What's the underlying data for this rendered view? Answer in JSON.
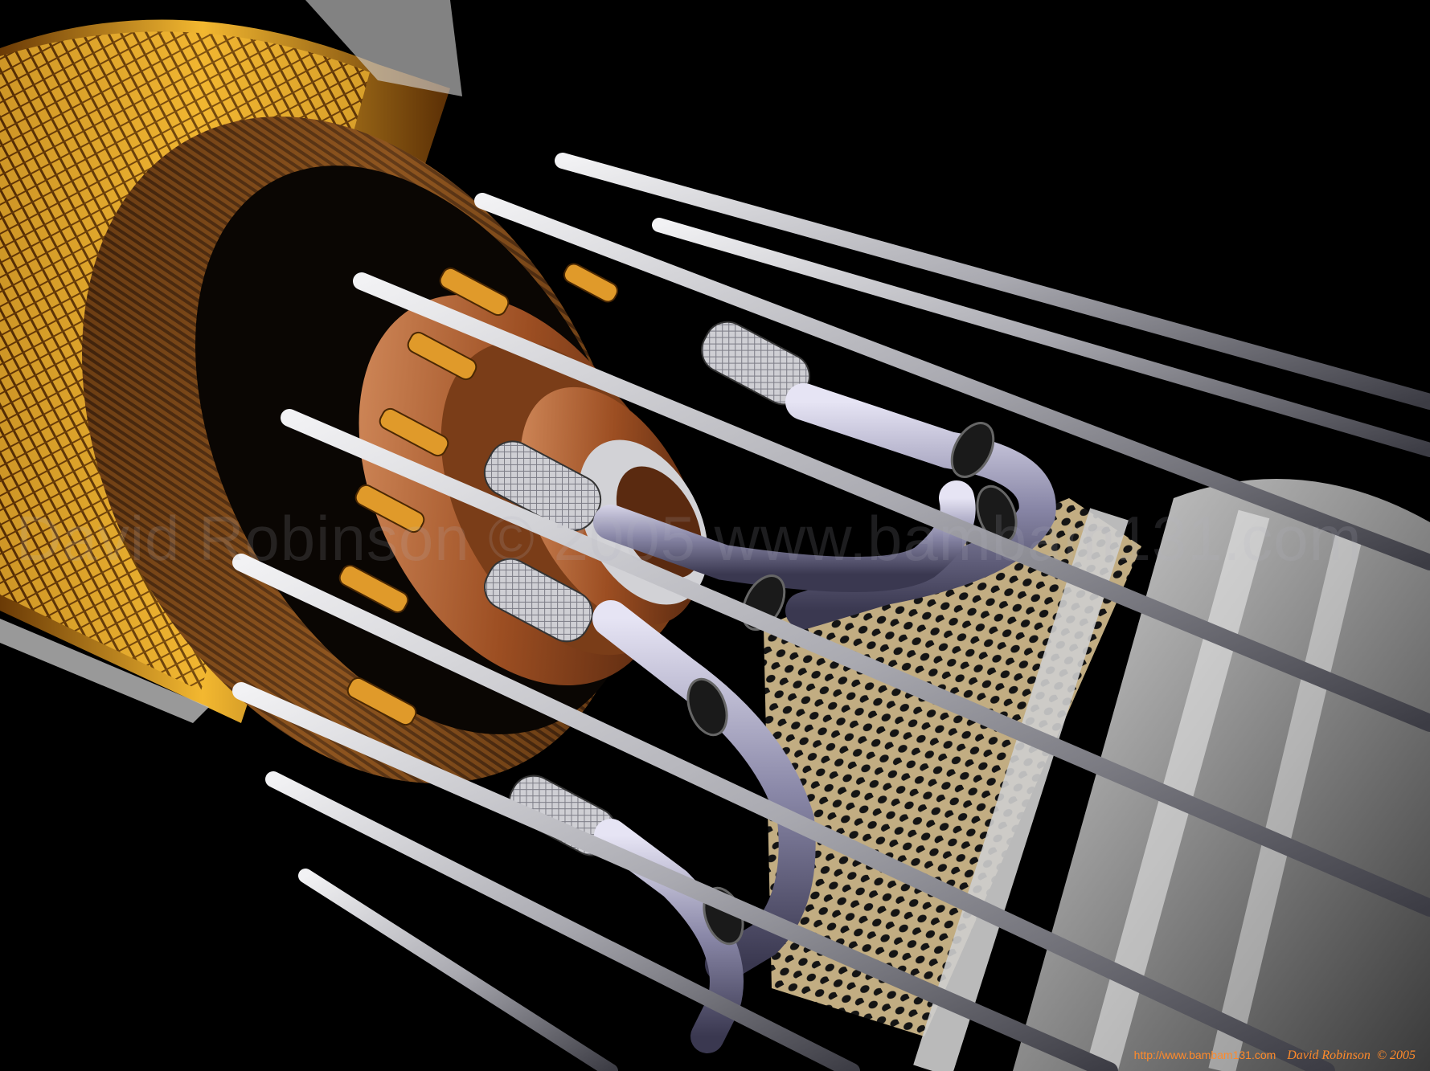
{
  "watermark_text": "David Robinson © 2005 www.bambam131.com",
  "credit": {
    "url": "http://www.bambam131.com",
    "signature": "David Robinson",
    "year": "© 2005"
  },
  "colors": {
    "background": "#000000",
    "copper": "#b5673a",
    "gold": "#e0a020",
    "steel": "#c8c8cc",
    "mesh": "#b8a37a",
    "credit_text": "#ff8a2a"
  }
}
